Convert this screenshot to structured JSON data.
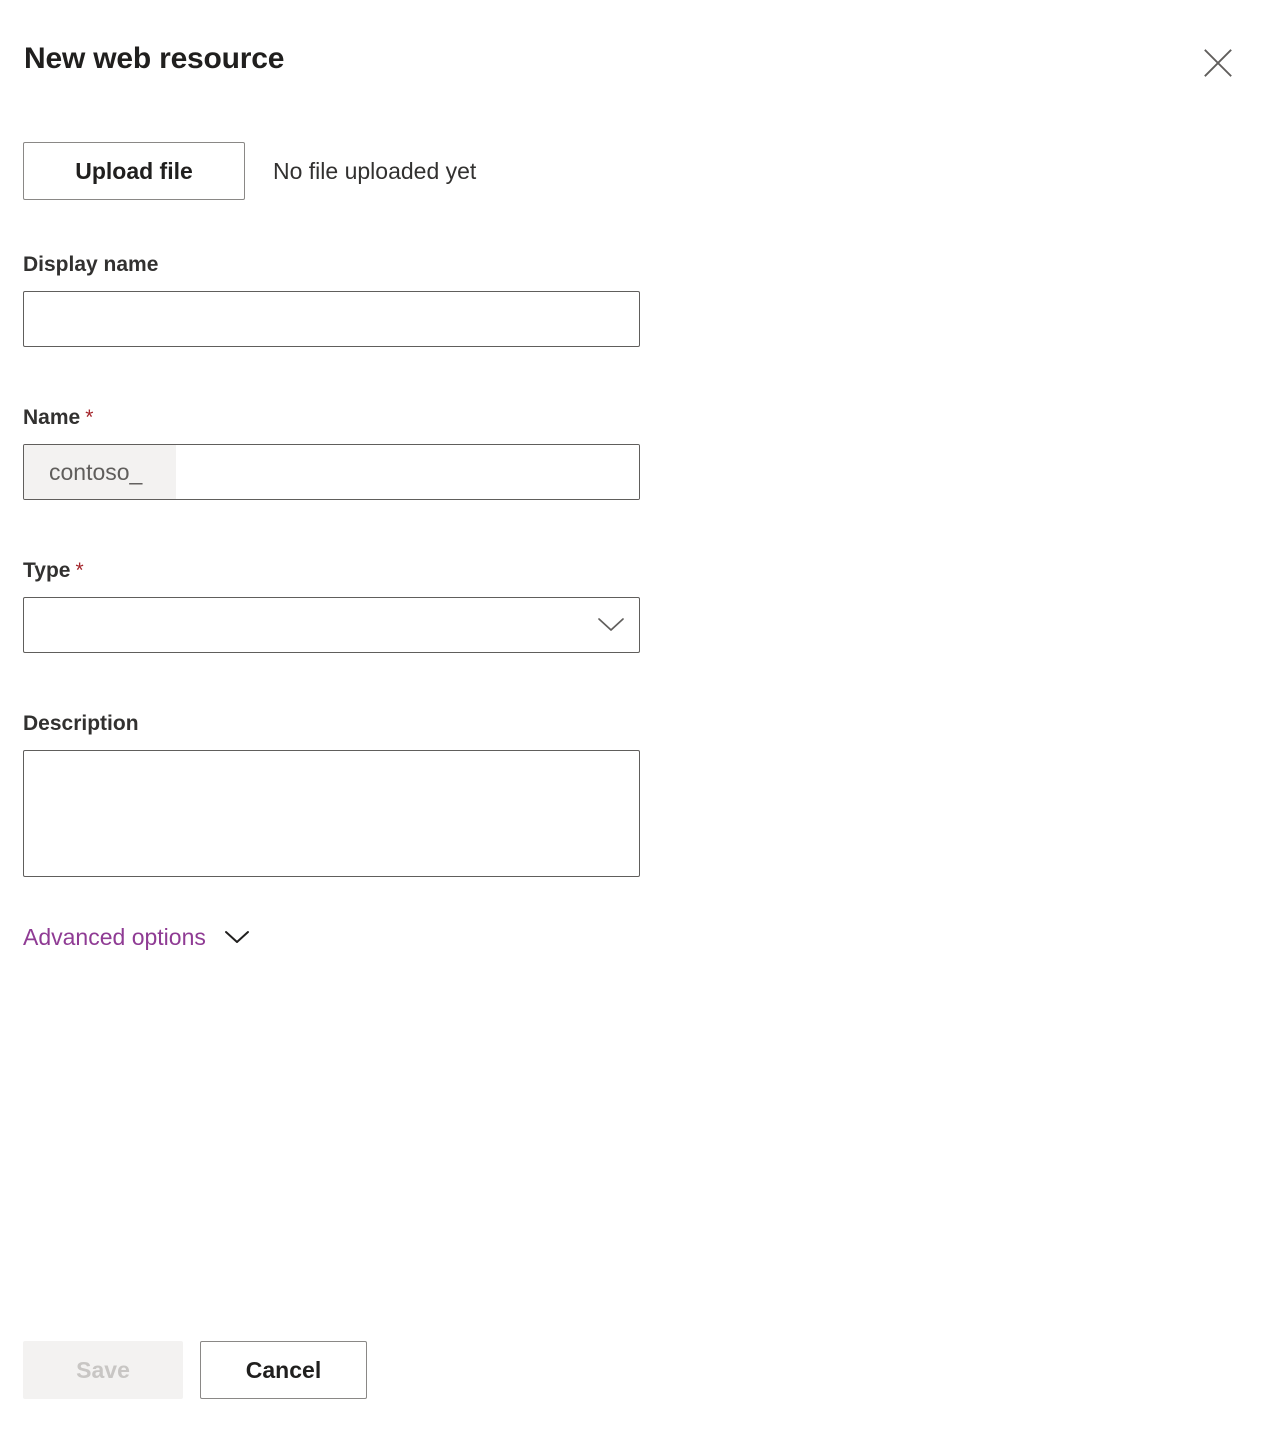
{
  "dialog": {
    "title": "New web resource",
    "close_icon": "close-icon"
  },
  "upload": {
    "button_label": "Upload file",
    "status_text": "No file uploaded yet"
  },
  "fields": {
    "display_name": {
      "label": "Display name",
      "value": "",
      "placeholder": ""
    },
    "name": {
      "label": "Name",
      "required_marker": "*",
      "prefix": "contoso_",
      "value": "",
      "placeholder": ""
    },
    "type": {
      "label": "Type",
      "required_marker": "*",
      "value": "",
      "chevron_icon": "chevron-down-icon"
    },
    "description": {
      "label": "Description",
      "value": "",
      "placeholder": ""
    }
  },
  "advanced": {
    "label": "Advanced options",
    "chevron_icon": "chevron-down-icon"
  },
  "footer": {
    "save_label": "Save",
    "cancel_label": "Cancel"
  },
  "colors": {
    "accent_purple": "#8f3b94",
    "required_red": "#a4262c",
    "text_primary": "#201f1e",
    "text_secondary": "#323130",
    "border": "#605e5c",
    "border_button": "#8a8886",
    "disabled_bg": "#f3f2f1",
    "disabled_text": "#c8c6c4"
  }
}
